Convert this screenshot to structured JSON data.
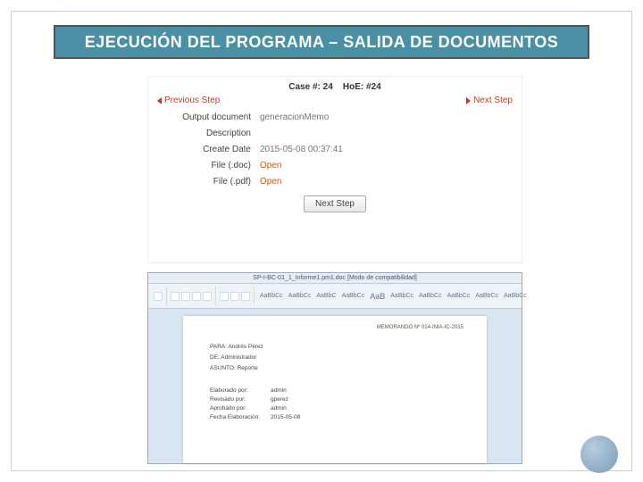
{
  "slide": {
    "title": "EJECUCIÓN DEL PROGRAMA – SALIDA DE DOCUMENTOS"
  },
  "web": {
    "caseLabel": "Case #: 24",
    "hoeLabel": "HoE: #24",
    "prevStep": "Previous Step",
    "nextStep": "Next Step",
    "rows": {
      "outputDocLabel": "Output document",
      "outputDocValue": "generacionMemo",
      "descriptionLabel": "Description",
      "descriptionValue": "",
      "createDateLabel": "Create Date",
      "createDateValue": "2015-05-08 00:37:41",
      "fileDocLabel": "File (.doc)",
      "fileDocLink": "Open",
      "filePdfLabel": "File (.pdf)",
      "filePdfLink": "Open"
    },
    "nextBtn": "Next Step"
  },
  "word": {
    "windowTitle": "SP-I-BC-01_1_Informe1.pm1.doc [Modo de compatibilidad]",
    "styles": [
      "AaBbCc",
      "AaBbCc",
      "AaBbC",
      "AaBbCc",
      "AaB",
      "AaBbCc",
      "AaBbCc",
      "AaBbCc",
      "AaBbCc",
      "AaBbCc"
    ],
    "memoHeader": "MEMORANDO Nº 014-INIA-IC-2015",
    "lines": {
      "para": "PARA: Andrés Pérez",
      "de": "DE: Administrador",
      "asunto": "ASUNTO: Reporte"
    },
    "pairs": [
      {
        "k": "Elaborado por:",
        "v": "admin"
      },
      {
        "k": "Revisado por:",
        "v": "gperez"
      },
      {
        "k": "Aprobado por:",
        "v": "admin"
      },
      {
        "k": "Fecha Elaboración:",
        "v": "2015-05-08"
      }
    ]
  }
}
